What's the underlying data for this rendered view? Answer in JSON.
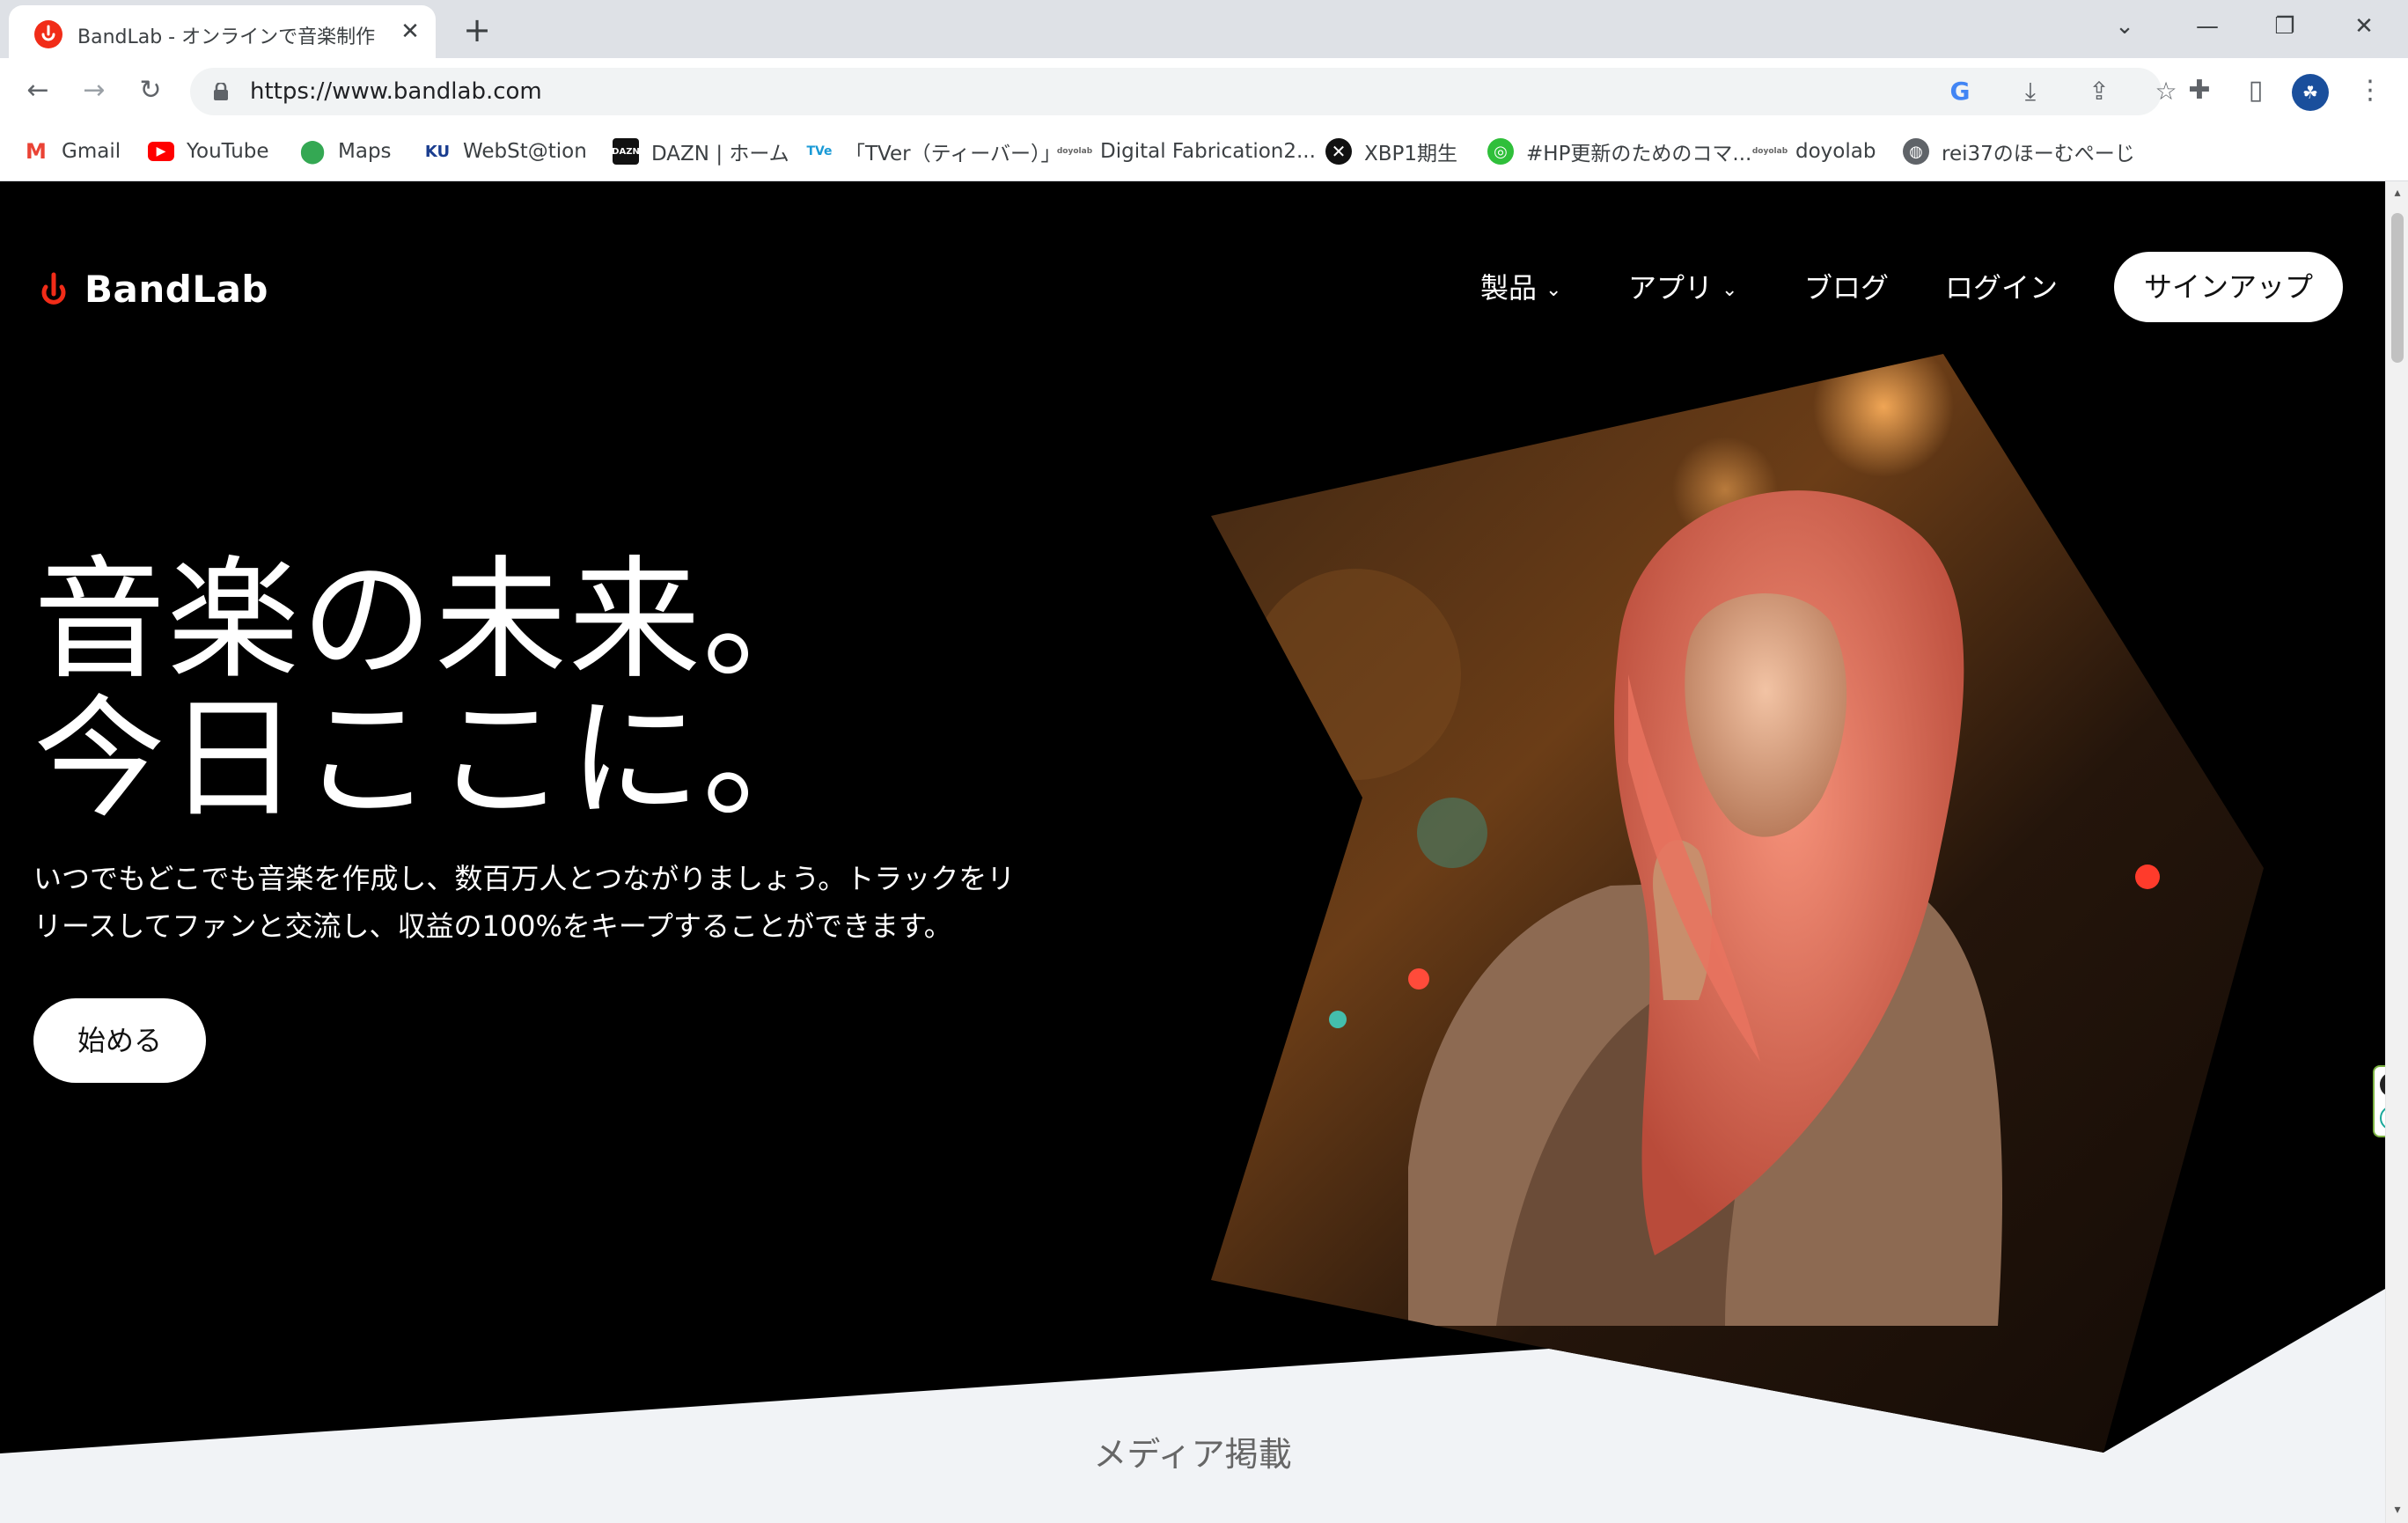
{
  "browser": {
    "tab_title": "BandLab - オンラインで音楽制作",
    "url": "https://www.bandlab.com",
    "new_tab_symbol": "+",
    "bookmarks": [
      {
        "label": "Gmail",
        "icon": "gmail-icon"
      },
      {
        "label": "YouTube",
        "icon": "youtube-icon"
      },
      {
        "label": "Maps",
        "icon": "maps-icon"
      },
      {
        "label": "WebSt@tion",
        "icon": "ku-icon"
      },
      {
        "label": "DAZN | ホーム",
        "icon": "dazn-icon"
      },
      {
        "label": "「TVer（ティーバー）」",
        "icon": "tver-icon"
      },
      {
        "label": "Digital Fabrication2...",
        "icon": "doyolab-icon"
      },
      {
        "label": "XBP1期生",
        "icon": "xbp-icon"
      },
      {
        "label": "#HP更新のためのコマ...",
        "icon": "hp-icon"
      },
      {
        "label": "doyolab",
        "icon": "doyolab-icon"
      },
      {
        "label": "rei37のほーむぺーじ",
        "icon": "globe-icon"
      }
    ]
  },
  "site": {
    "logo_text": "BandLab",
    "nav": {
      "products": "製品",
      "apps": "アプリ",
      "blog": "ブログ",
      "login": "ログイン",
      "signup": "サインアップ"
    },
    "hero": {
      "title_line1": "音楽の未来。",
      "title_line2": "今日ここに。",
      "subtitle": "いつでもどこでも音楽を作成し、数百万人とつながりましょう。トラックをリリースしてファンと交流し、収益の100%をキープすることができます。",
      "cta": "始める"
    },
    "media_title": "メディア掲載"
  },
  "colors": {
    "brand": "#f12c18",
    "hero_bg": "#000000",
    "section_bg": "#f1f3f6"
  }
}
